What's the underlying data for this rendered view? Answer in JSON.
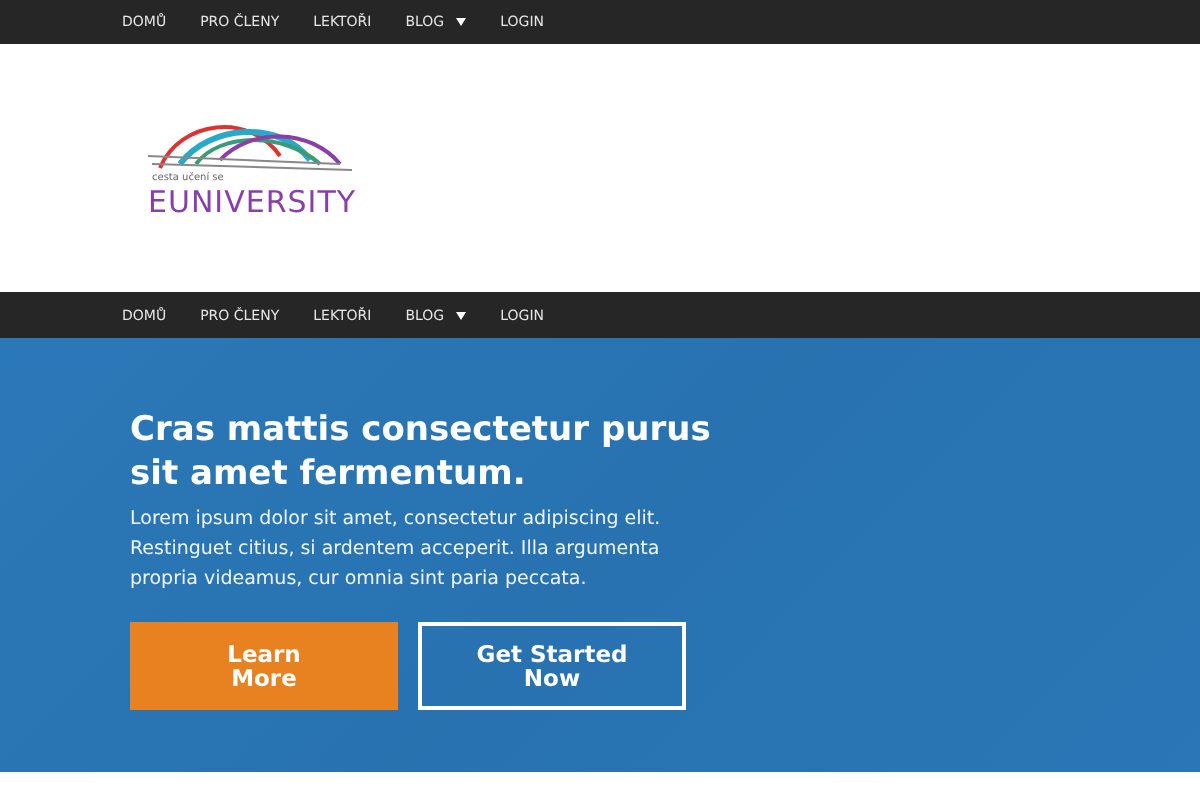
{
  "top_nav": {
    "items": [
      {
        "label": "DOMŮ",
        "has_dropdown": false
      },
      {
        "label": "PRO ČLENY",
        "has_dropdown": false
      },
      {
        "label": "LEKTOŘI",
        "has_dropdown": false
      },
      {
        "label": "BLOG",
        "has_dropdown": true
      },
      {
        "label": "LOGIN",
        "has_dropdown": false
      }
    ]
  },
  "logo": {
    "tagline": "cesta učení se",
    "name": "EUNIVERSITY"
  },
  "main_nav": {
    "items": [
      {
        "label": "DOMŮ",
        "has_dropdown": false
      },
      {
        "label": "PRO ČLENY",
        "has_dropdown": false
      },
      {
        "label": "LEKTOŘI",
        "has_dropdown": false
      },
      {
        "label": "BLOG",
        "has_dropdown": true
      },
      {
        "label": "LOGIN",
        "has_dropdown": false
      }
    ]
  },
  "hero": {
    "title": "Cras mattis consectetur purus sit amet fermentum.",
    "text": "Lorem ipsum dolor sit amet, consectetur adipiscing elit. Restinguet citius, si ardentem acceperit. Illa argumenta propria videamus, cur omnia sint paria peccata.",
    "buttons": [
      {
        "label": "Learn More",
        "kind": "solid"
      },
      {
        "label": "Get Started Now",
        "kind": "outline"
      }
    ]
  }
}
